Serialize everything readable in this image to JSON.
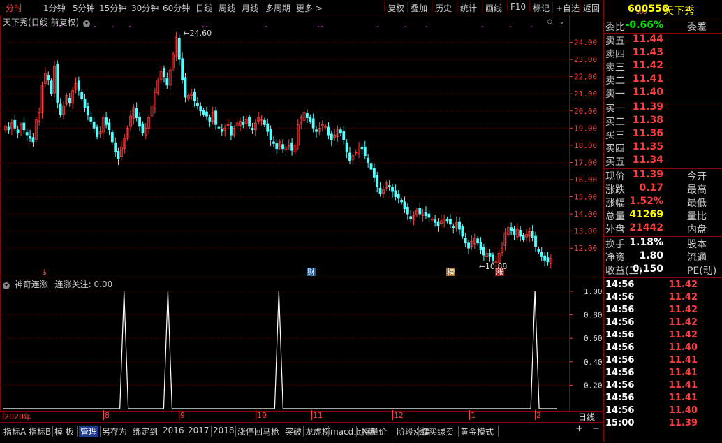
{
  "toolbar": {
    "left": [
      "分时",
      "1分钟",
      "5分钟",
      "15分钟",
      "30分钟",
      "60分钟",
      "日线",
      "周线",
      "月线",
      "多周期",
      "更多 >"
    ],
    "right": [
      "复权",
      "叠加",
      "历史",
      "统计",
      "画线",
      "F10",
      "标记",
      "+自选",
      "返回"
    ],
    "active": "分时"
  },
  "stock": {
    "code": "600556",
    "name": "天下秀",
    "small": "500"
  },
  "chart": {
    "title": "天下秀(日线 前复权)",
    "y_ticks": [
      "24.00",
      "23.00",
      "22.00",
      "21.00",
      "20.00",
      "19.00",
      "18.00",
      "17.00",
      "16.00",
      "15.00",
      "14.00",
      "13.00",
      "12.00"
    ],
    "high_label": "24.60",
    "low_label": "10.88",
    "markers": [
      "$",
      "财",
      "榜",
      "涨"
    ]
  },
  "indicator": {
    "title": "神奇连涨",
    "subtitle": "连涨关注: 0.00",
    "y_ticks": [
      "1.00",
      "0.80",
      "0.60",
      "0.40",
      "0.20"
    ]
  },
  "dates": [
    "2020年",
    "8",
    "9",
    "10",
    "11",
    "12",
    "1",
    "2"
  ],
  "period_label": "日线",
  "quote": {
    "weibi_label": "委比",
    "weibi": "-0.66%",
    "weicha": "委差",
    "sell": [
      {
        "l": "卖五",
        "v": "11.44"
      },
      {
        "l": "卖四",
        "v": "11.43"
      },
      {
        "l": "卖三",
        "v": "11.42"
      },
      {
        "l": "卖二",
        "v": "11.41"
      },
      {
        "l": "卖一",
        "v": "11.40"
      }
    ],
    "buy": [
      {
        "l": "买一",
        "v": "11.39"
      },
      {
        "l": "买二",
        "v": "11.38"
      },
      {
        "l": "买三",
        "v": "11.36"
      },
      {
        "l": "买四",
        "v": "11.35"
      },
      {
        "l": "买五",
        "v": "11.34"
      }
    ],
    "stats": [
      {
        "l": "现价",
        "v": "11.39",
        "r": "今开"
      },
      {
        "l": "涨跌",
        "v": "0.17",
        "r": "最高"
      },
      {
        "l": "涨幅",
        "v": "1.52%",
        "r": "最低"
      },
      {
        "l": "总量",
        "v": "41269",
        "r": "量比"
      },
      {
        "l": "外盘",
        "v": "21442",
        "r": "内盘"
      }
    ],
    "stats2": [
      {
        "l": "换手",
        "v": "1.18%",
        "r": "股本"
      },
      {
        "l": "净资",
        "v": "1.80",
        "r": "流通"
      },
      {
        "l": "收益(三)",
        "v": "0.150",
        "r": "PE(动)"
      }
    ]
  },
  "ticks": [
    {
      "t": "14:56",
      "p": "11.42"
    },
    {
      "t": "14:56",
      "p": "11.42"
    },
    {
      "t": "14:56",
      "p": "11.42"
    },
    {
      "t": "14:56",
      "p": "11.42"
    },
    {
      "t": "14:56",
      "p": "11.42"
    },
    {
      "t": "14:56",
      "p": "11.40"
    },
    {
      "t": "14:56",
      "p": "11.41"
    },
    {
      "t": "14:56",
      "p": "11.41"
    },
    {
      "t": "14:56",
      "p": "11.41"
    },
    {
      "t": "14:56",
      "p": "11.41"
    },
    {
      "t": "14:56",
      "p": "11.40"
    },
    {
      "t": "15:00",
      "p": "11.39"
    }
  ],
  "bottom": [
    "指标A",
    "指标B",
    "模 板",
    "管理",
    "另存为",
    "绑定到",
    "2016",
    "2017",
    "2018",
    "涨停回马枪",
    "突破",
    "龙虎榜",
    "macd上拐量价",
    "小草",
    "阶段涨幅",
    "红买绿卖",
    "黄金模式"
  ],
  "bottom_selected": "管理",
  "bottom_right": [
    "+",
    "−"
  ],
  "chart_data": {
    "type": "candlestick",
    "ylim": [
      10.5,
      25.0
    ],
    "closes": [
      19.1,
      18.9,
      19.3,
      19.0,
      18.7,
      19.2,
      18.9,
      18.6,
      18.4,
      18.2,
      19.5,
      19.9,
      21.5,
      22.2,
      21.8,
      21.0,
      22.6,
      20.5,
      19.8,
      20.3,
      20.9,
      20.5,
      21.2,
      21.6,
      21.2,
      20.7,
      20.2,
      19.8,
      19.4,
      19.0,
      18.5,
      18.8,
      19.6,
      19.2,
      18.9,
      18.2,
      17.6,
      17.2,
      17.9,
      18.4,
      19.0,
      19.7,
      20.2,
      19.6,
      19.1,
      18.7,
      19.0,
      19.6,
      20.3,
      21.1,
      21.8,
      22.3,
      22.0,
      21.5,
      22.4,
      23.3,
      24.3,
      23.0,
      21.8,
      20.8,
      20.9,
      21.0,
      20.6,
      20.3,
      20.0,
      19.8,
      19.7,
      19.4,
      19.9,
      19.2,
      19.0,
      18.8,
      19.0,
      19.2,
      18.6,
      19.0,
      19.3,
      19.4,
      19.2,
      19.5,
      19.1,
      18.9,
      19.3,
      19.6,
      19.5,
      19.2,
      18.8,
      18.3,
      18.1,
      17.8,
      18.2,
      17.8,
      17.9,
      18.0,
      17.7,
      18.0,
      19.2,
      19.6,
      19.9,
      19.6,
      19.4,
      19.0,
      18.8,
      19.0,
      19.2,
      19.1,
      18.6,
      18.3,
      18.6,
      18.9,
      18.7,
      18.3,
      17.6,
      17.1,
      17.4,
      17.6,
      17.9,
      17.8,
      17.4,
      17.0,
      16.6,
      16.1,
      15.6,
      15.2,
      15.4,
      15.8,
      15.6,
      15.3,
      15.0,
      14.9,
      14.7,
      14.3,
      14.0,
      13.7,
      13.9,
      14.2,
      14.0,
      14.1,
      13.9,
      13.8,
      13.7,
      13.5,
      13.3,
      13.6,
      13.7,
      13.6,
      13.4,
      13.2,
      13.5,
      13.1,
      12.7,
      12.3,
      12.0,
      12.4,
      12.6,
      12.3,
      11.9,
      11.6,
      11.7,
      11.5,
      11.3,
      11.2,
      11.7,
      12.0,
      12.9,
      13.2,
      13.0,
      12.8,
      13.1,
      12.7,
      12.5,
      12.8,
      13.0,
      12.6,
      12.1,
      11.8,
      11.5,
      11.3,
      11.2,
      11.4
    ],
    "indicator_spikes_x_fraction": [
      0.218,
      0.295,
      0.49,
      0.94
    ]
  }
}
